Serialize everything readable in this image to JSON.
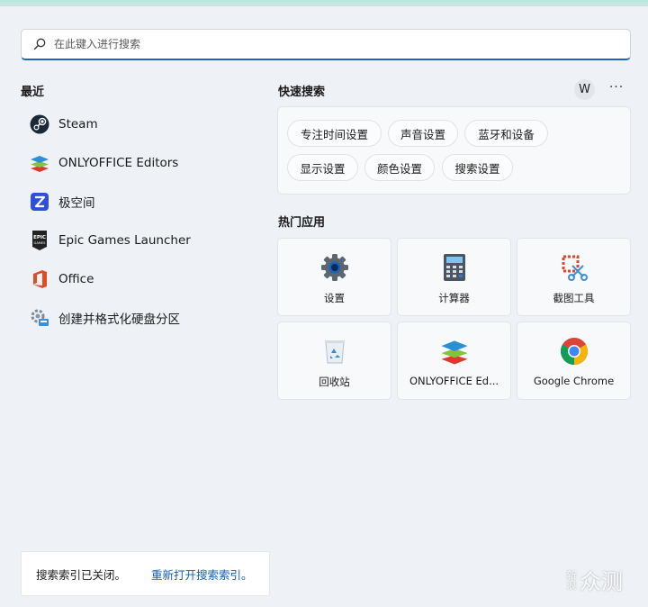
{
  "search": {
    "placeholder": "在此键入进行搜索"
  },
  "recent": {
    "title": "最近",
    "items": [
      {
        "label": "Steam",
        "icon": "steam-icon"
      },
      {
        "label": "ONLYOFFICE Editors",
        "icon": "onlyoffice-icon"
      },
      {
        "label": "极空间",
        "icon": "zspace-icon"
      },
      {
        "label": "Epic Games Launcher",
        "icon": "epic-games-icon"
      },
      {
        "label": "Office",
        "icon": "office-icon"
      },
      {
        "label": "创建并格式化硬盘分区",
        "icon": "disk-management-icon"
      }
    ]
  },
  "quick_search": {
    "title": "快速搜索",
    "avatar_letter": "W",
    "more": "···",
    "chips": [
      "专注时间设置",
      "声音设置",
      "蓝牙和设备",
      "显示设置",
      "颜色设置",
      "搜索设置"
    ]
  },
  "popular_apps": {
    "title": "热门应用",
    "tiles": [
      {
        "label": "设置",
        "icon": "settings-gear-icon"
      },
      {
        "label": "计算器",
        "icon": "calculator-icon"
      },
      {
        "label": "截图工具",
        "icon": "snipping-tool-icon"
      },
      {
        "label": "回收站",
        "icon": "recycle-bin-icon"
      },
      {
        "label": "ONLYOFFICE Ed...",
        "icon": "onlyoffice-icon"
      },
      {
        "label": "Google Chrome",
        "icon": "chrome-icon"
      }
    ]
  },
  "status": {
    "message": "搜索索引已关闭。",
    "link": "重新打开搜索索引。"
  },
  "watermark": {
    "small": "新浪",
    "big": "众测"
  },
  "colors": {
    "accent": "#1a66c2",
    "link": "#0f5fb8",
    "panel": "#eef1f5"
  }
}
